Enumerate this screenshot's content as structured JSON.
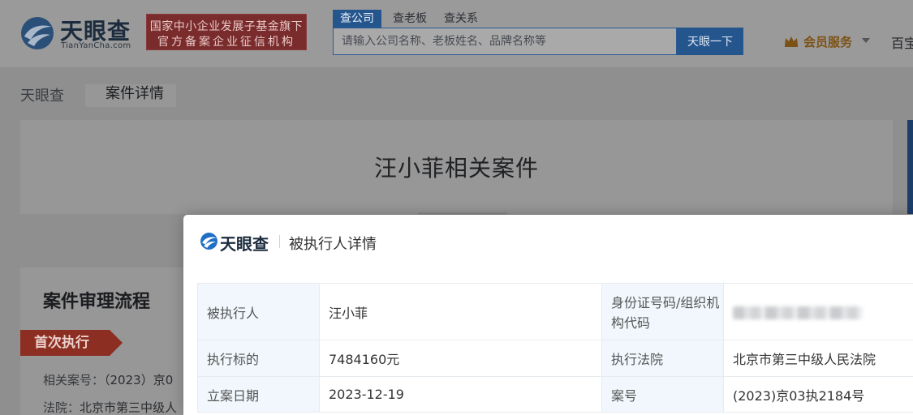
{
  "header": {
    "logo_cn": "天眼查",
    "logo_en": "TianYanCha.com",
    "badge_line1": "国家中小企业发展子基金旗下",
    "badge_line2": "官方备案企业征信机构",
    "search_tabs": [
      "查公司",
      "查老板",
      "查关系"
    ],
    "search_placeholder": "请输入公司名称、老板姓名、品牌名称等",
    "search_button": "天眼一下",
    "vip_label": "会员服务",
    "more_link": "百宝"
  },
  "breadcrumb": {
    "home": "天眼查",
    "current": "案件详情"
  },
  "page": {
    "title": "汪小菲相关案件"
  },
  "flow": {
    "title": "案件审理流程",
    "tag": "首次执行",
    "case_no_label": "相关案号：",
    "case_no_value": "（2023）京0",
    "court_label": "法院：",
    "court_value": "北京市第三中级人"
  },
  "modal": {
    "logo_cn": "天眼查",
    "title": "被执行人详情",
    "rows": [
      {
        "k1": "被执行人",
        "v1": "汪小菲",
        "k2": "身份证号码/组织机构代码",
        "v2": ""
      },
      {
        "k1": "执行标的",
        "v1": "7484160元",
        "k2": "执行法院",
        "v2": "北京市第三中级人民法院"
      },
      {
        "k1": "立案日期",
        "v1": "2023-12-19",
        "k2": "案号",
        "v2": "(2023)京03执2184号"
      }
    ]
  },
  "colors": {
    "brand_blue": "#2b6cb0",
    "overlay_dim": "#8f8f8f",
    "tag_red": "#c0392b",
    "key_cell_bg": "#f1f7fc"
  }
}
